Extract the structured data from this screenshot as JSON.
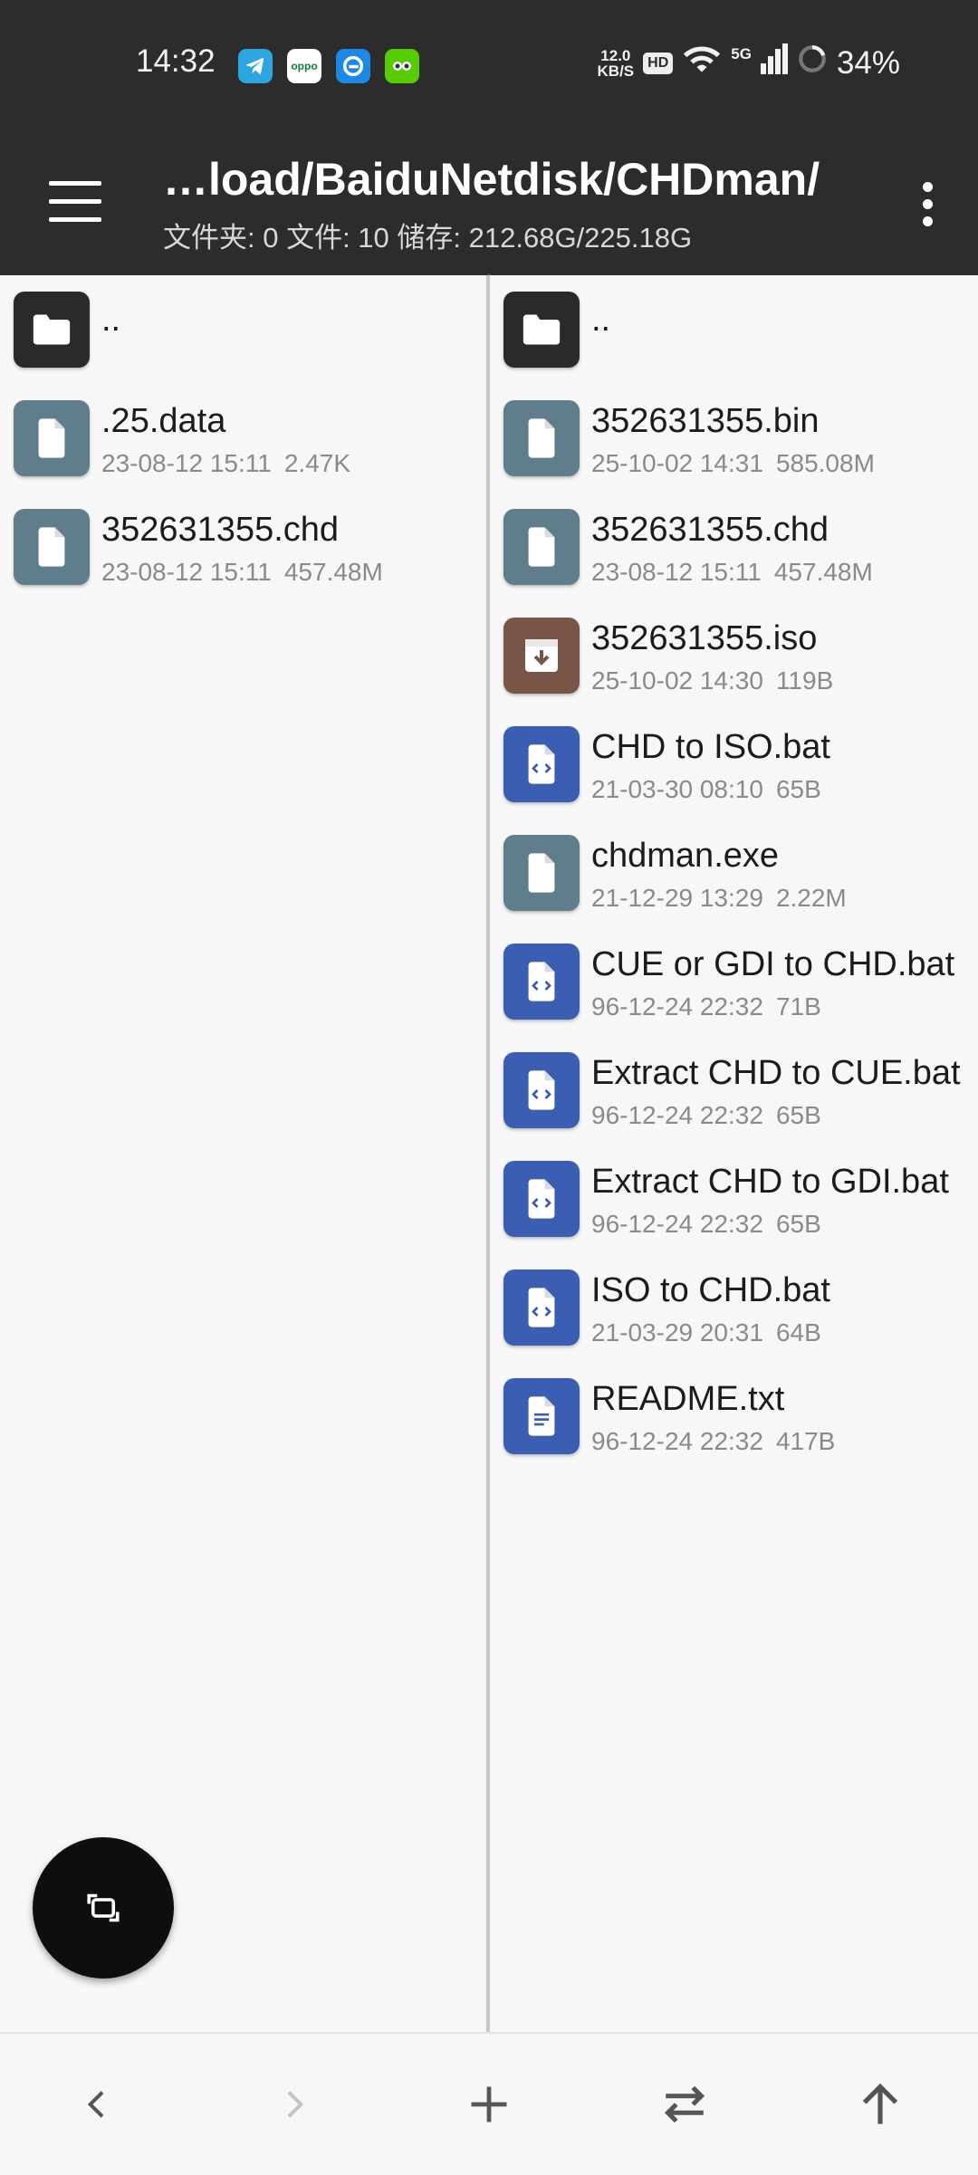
{
  "status_bar": {
    "time": "14:32",
    "speed_value": "12.0",
    "speed_unit": "KB/S",
    "hd_label": "HD",
    "network_label": "5G",
    "battery": "34%",
    "app_icons": [
      "telegram-icon",
      "oppo-icon",
      "edge-icon",
      "duolingo-icon"
    ]
  },
  "app_bar": {
    "path": "…load/BaiduNetdisk/CHDman/",
    "summary": "文件夹: 0  文件: 10  储存: 212.68G/225.18G"
  },
  "colors": {
    "folder": "#2a2a2a",
    "generic_file": "#607d8b",
    "archive": "#795548",
    "script": "#3b5db2",
    "text": "#3b5db2"
  },
  "left_pane": {
    "items": [
      {
        "name": "..",
        "date": "",
        "size": "",
        "icon": "folder-icon"
      },
      {
        "name": ".25.data",
        "date": "23-08-12 15:11",
        "size": "2.47K",
        "icon": "file-icon"
      },
      {
        "name": "352631355.chd",
        "date": "23-08-12 15:11",
        "size": "457.48M",
        "icon": "file-icon"
      }
    ]
  },
  "right_pane": {
    "items": [
      {
        "name": "..",
        "date": "",
        "size": "",
        "icon": "folder-icon"
      },
      {
        "name": "352631355.bin",
        "date": "25-10-02 14:31",
        "size": "585.08M",
        "icon": "file-icon"
      },
      {
        "name": "352631355.chd",
        "date": "23-08-12 15:11",
        "size": "457.48M",
        "icon": "file-icon"
      },
      {
        "name": "352631355.iso",
        "date": "25-10-02 14:30",
        "size": "119B",
        "icon": "archive-icon"
      },
      {
        "name": "CHD to ISO.bat",
        "date": "21-03-30 08:10",
        "size": "65B",
        "icon": "code-file-icon"
      },
      {
        "name": "chdman.exe",
        "date": "21-12-29 13:29",
        "size": "2.22M",
        "icon": "file-icon"
      },
      {
        "name": "CUE or GDI to CHD.bat",
        "date": "96-12-24 22:32",
        "size": "71B",
        "icon": "code-file-icon"
      },
      {
        "name": "Extract CHD to CUE.bat",
        "date": "96-12-24 22:32",
        "size": "65B",
        "icon": "code-file-icon"
      },
      {
        "name": "Extract CHD to GDI.bat",
        "date": "96-12-24 22:32",
        "size": "65B",
        "icon": "code-file-icon"
      },
      {
        "name": "ISO to CHD.bat",
        "date": "21-03-29 20:31",
        "size": "64B",
        "icon": "code-file-icon"
      },
      {
        "name": "README.txt",
        "date": "96-12-24 22:32",
        "size": "417B",
        "icon": "text-file-icon"
      }
    ]
  },
  "bottom_bar": {
    "buttons": [
      "back-icon",
      "forward-icon",
      "add-icon",
      "swap-icon",
      "up-icon"
    ]
  },
  "fab": {
    "icon": "switch-pane-icon"
  }
}
